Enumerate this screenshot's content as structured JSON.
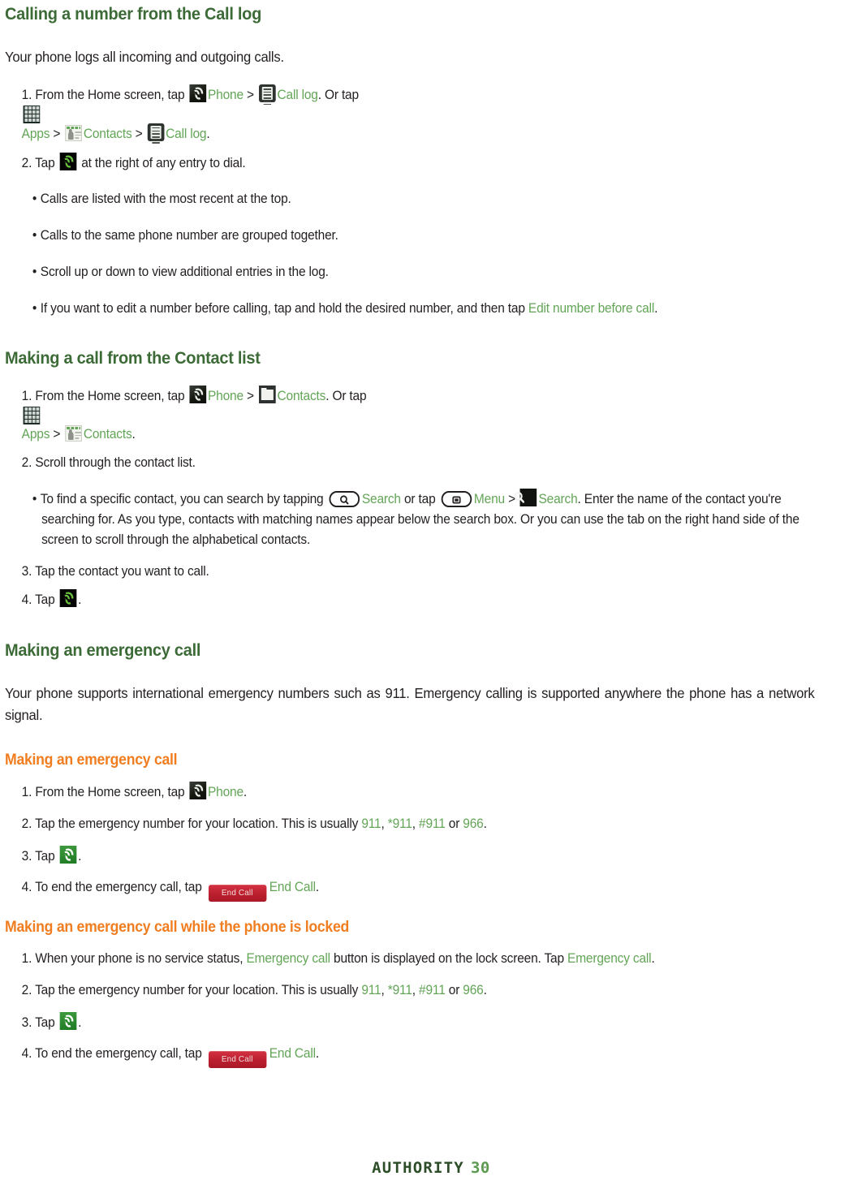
{
  "page": {
    "footer_brand": "AUTHORITY",
    "footer_page_number": "30"
  },
  "colors": {
    "heading_green": "#3c6b37",
    "subheading_orange": "#f07d20",
    "link_green": "#63a557",
    "body_text": "#231f20",
    "end_call_red": "#bb1f2e"
  },
  "sections": {
    "call_log": {
      "heading": "Calling a number from the Call log",
      "intro": "Your phone logs all incoming and outgoing calls.",
      "step1": {
        "num": "1. ",
        "t1": "From the Home screen, tap ",
        "phone": "Phone",
        "sep1": " > ",
        "calllog": "Call log",
        "t2": ". Or tap ",
        "apps": "Apps",
        "sep2": " > ",
        "contacts": "Contacts",
        "sep3": " > ",
        "calllog2": "Call log",
        "t3": "."
      },
      "step2": {
        "num": "2. ",
        "t1": "Tap ",
        "t2": " at the right of any entry to dial."
      },
      "bullets": [
        "Calls are listed with the most recent at the top.",
        "Calls to the same phone number are grouped together.",
        "Scroll up or down to view additional entries in the log."
      ],
      "bullet4": {
        "t1": "If you want to edit a number before calling, tap and hold the desired number, and then tap ",
        "link": "Edit number before call",
        "t2": "."
      }
    },
    "contact_list": {
      "heading": "Making a call from the Contact list",
      "step1": {
        "num": "1. ",
        "t1": "From the Home screen, tap ",
        "phone": "Phone",
        "sep1": " > ",
        "contacts": "Contacts",
        "t2": ". Or tap ",
        "apps": "Apps",
        "sep2": " > ",
        "contacts2": "Contacts",
        "t3": "."
      },
      "step2": "2. Scroll through the contact list.",
      "bullet1": {
        "t1": "To find a specific contact, you can search by tapping ",
        "search_key": "Search",
        "t2": " or tap ",
        "menu_key": "Menu",
        "sep": " > ",
        "search_tile": "Search",
        "t3": ". Enter the name of the contact you're searching for. As you type, contacts with matching names appear below the search box. Or you can use the tab on the right hand side of the screen to scroll through the alphabetical contacts."
      },
      "step3": "3. Tap the contact you want to call.",
      "step4": {
        "num": "4. ",
        "t1": "Tap ",
        "t2": "."
      }
    },
    "emergency": {
      "heading": "Making an emergency call",
      "intro": "Your phone supports international emergency numbers such as 911. Emergency calling is supported anywhere the phone has a network signal.",
      "sub1": {
        "heading": "Making an emergency call",
        "step1": {
          "num": "1. ",
          "t1": "From the Home screen, tap ",
          "phone": "Phone",
          "t2": "."
        },
        "step2": {
          "num": "2. ",
          "t1": "Tap the emergency number for your location. This is usually ",
          "n1": "911",
          "c1": ", ",
          "n2": "*911",
          "c2": ", ",
          "n3": "#911",
          "c3": " or ",
          "n4": "966",
          "t2": "."
        },
        "step3": {
          "num": "3. ",
          "t1": "Tap ",
          "t2": "."
        },
        "step4": {
          "num": "4. ",
          "t1": "To end the emergency call, tap ",
          "btn": "End Call",
          "label": "End Call",
          "t2": "."
        }
      },
      "sub2": {
        "heading": "Making an emergency call while the phone is locked",
        "step1": {
          "num": "1. ",
          "t1": "When your phone is no service status, ",
          "link1": "Emergency call",
          "t2": " button is displayed on the lock screen. Tap ",
          "link2": "Emergency call",
          "t3": "."
        },
        "step2": {
          "num": "2. ",
          "t1": "Tap the emergency number for your location. This is usually ",
          "n1": "911",
          "c1": ", ",
          "n2": "*911",
          "c2": ", ",
          "n3": "#911",
          "c3": " or ",
          "n4": "966",
          "t2": "."
        },
        "step3": {
          "num": "3. ",
          "t1": "Tap ",
          "t2": "."
        },
        "step4": {
          "num": "4. ",
          "t1": "To end the emergency call, tap ",
          "btn": "End Call",
          "label": "End Call",
          "t2": "."
        }
      }
    }
  }
}
